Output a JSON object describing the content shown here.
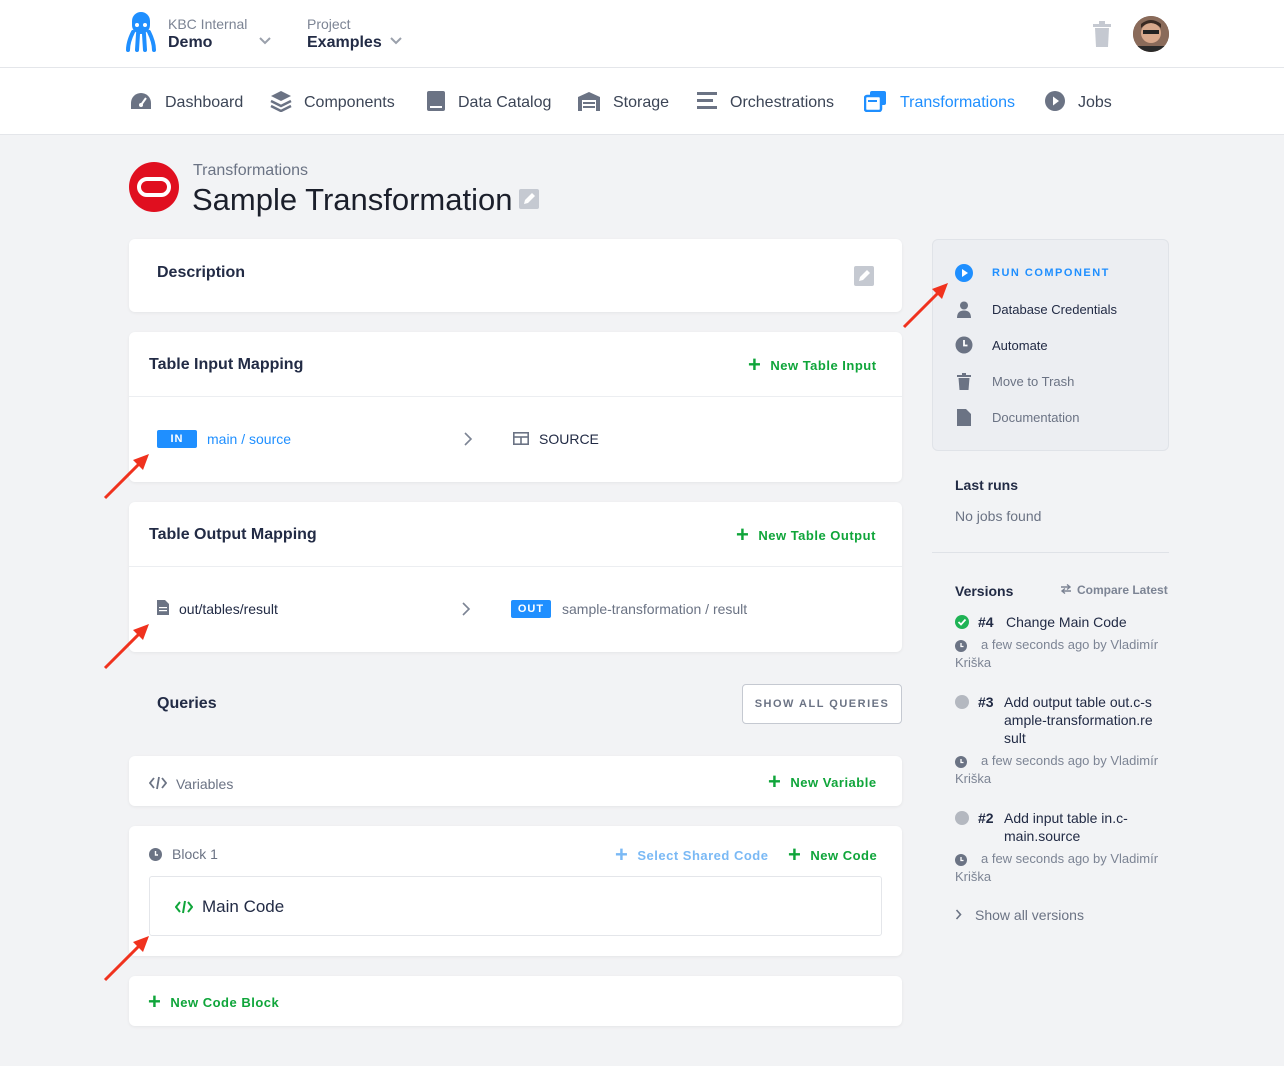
{
  "header": {
    "org_label": "KBC Internal",
    "org_value": "Demo",
    "project_label": "Project",
    "project_value": "Examples"
  },
  "nav": [
    {
      "label": "Dashboard",
      "icon": "dashboard-icon"
    },
    {
      "label": "Components",
      "icon": "layers-icon"
    },
    {
      "label": "Data Catalog",
      "icon": "book-icon"
    },
    {
      "label": "Storage",
      "icon": "warehouse-icon"
    },
    {
      "label": "Orchestrations",
      "icon": "bars-icon"
    },
    {
      "label": "Transformations",
      "icon": "transform-icon",
      "active": true
    },
    {
      "label": "Jobs",
      "icon": "play-circle-icon"
    }
  ],
  "page": {
    "breadcrumb": "Transformations",
    "title": "Sample Transformation"
  },
  "description": {
    "title": "Description"
  },
  "input_mapping": {
    "title": "Table Input Mapping",
    "add_label": "New Table Input",
    "badge": "IN",
    "source": "main / source",
    "destination": "SOURCE"
  },
  "output_mapping": {
    "title": "Table Output Mapping",
    "add_label": "New Table Output",
    "source": "out/tables/result",
    "badge": "OUT",
    "destination": "sample-transformation / result"
  },
  "queries": {
    "title": "Queries",
    "show_all": "SHOW ALL QUERIES"
  },
  "variables": {
    "label": "Variables",
    "add_label": "New Variable"
  },
  "block": {
    "label": "Block 1",
    "select_shared": "Select Shared Code",
    "new_code": "New Code",
    "code_label": "Main Code"
  },
  "new_code_block": "New Code Block",
  "sidebar": {
    "actions": [
      {
        "label": "RUN COMPONENT",
        "icon": "play-circle-icon"
      },
      {
        "label": "Database Credentials",
        "icon": "user-icon"
      },
      {
        "label": "Automate",
        "icon": "clock-icon"
      },
      {
        "label": "Move to Trash",
        "icon": "trash-icon"
      },
      {
        "label": "Documentation",
        "icon": "file-icon"
      }
    ],
    "last_runs_title": "Last runs",
    "last_runs_empty": "No jobs found",
    "versions_title": "Versions",
    "compare_label": "Compare Latest",
    "versions": [
      {
        "num": "#4",
        "title": "Change Main Code",
        "meta": "a few seconds ago by Vladimír Kriška",
        "status_color": "#1fb355"
      },
      {
        "num": "#3",
        "title": "Add output table out.c-sample-transformation.result",
        "meta": "a few seconds ago by Vladimír Kriška",
        "status_color": "#b4b8c0"
      },
      {
        "num": "#2",
        "title": "Add input table in.c-main.source",
        "meta": "a few seconds ago by Vladimír Kriška",
        "status_color": "#b4b8c0"
      }
    ],
    "show_all_versions": "Show all versions"
  },
  "colors": {
    "accent": "#1f8fff",
    "green": "#0fa53a",
    "annotation_arrow": "#f0321e",
    "oracle_red": "#e00f1f"
  }
}
